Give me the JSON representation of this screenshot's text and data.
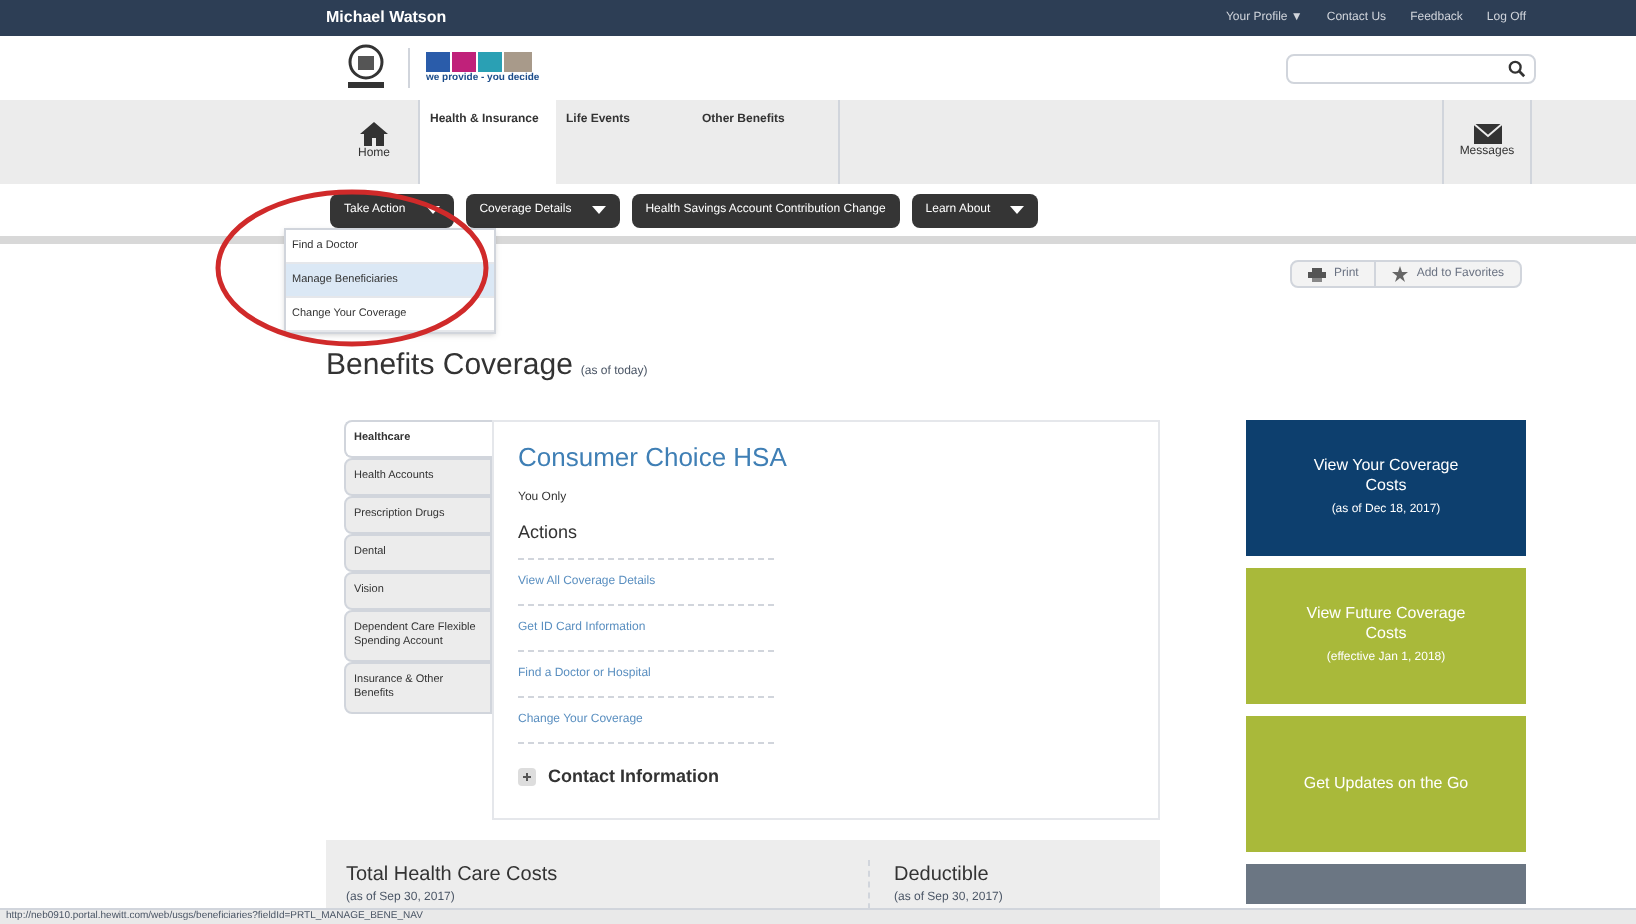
{
  "top_bar": {
    "user": "Michael Watson",
    "links": [
      "Your Profile ▼",
      "Contact Us",
      "Feedback",
      "Log Off"
    ]
  },
  "logo": {
    "tagline": "we provide - you decide"
  },
  "nav": {
    "home": "Home",
    "tabs": [
      {
        "label": "Health & Insurance",
        "selected": true
      },
      {
        "label": "Life Events",
        "selected": false
      },
      {
        "label": "Other Benefits",
        "selected": false
      }
    ],
    "messages": "Messages"
  },
  "subnav": [
    {
      "label": "Take Action",
      "dropdown": true
    },
    {
      "label": "Coverage Details",
      "dropdown": true
    },
    {
      "label": "Health Savings Account Contribution Change",
      "dropdown": false
    },
    {
      "label": "Learn About",
      "dropdown": true
    }
  ],
  "dropdown_menu": [
    {
      "label": "Find a Doctor",
      "selected": false
    },
    {
      "label": "Manage Beneficiaries",
      "selected": true
    },
    {
      "label": "Change Your Coverage",
      "selected": false
    }
  ],
  "page_tools": [
    "Print",
    "Add to Favorites"
  ],
  "heading": {
    "title": "Benefits Coverage",
    "note": "(as of today)"
  },
  "side_tabs": [
    {
      "label": "Healthcare",
      "selected": true
    },
    {
      "label": "Health Accounts",
      "selected": false
    },
    {
      "label": "Prescription Drugs",
      "selected": false
    },
    {
      "label": "Dental",
      "selected": false
    },
    {
      "label": "Vision",
      "selected": false
    },
    {
      "label": "Dependent Care Flexible Spending Account",
      "selected": false
    },
    {
      "label": "Insurance & Other Benefits",
      "selected": false
    }
  ],
  "plan": {
    "name": "Consumer Choice HSA",
    "coverage": "You Only",
    "actions_title": "Actions",
    "actions": [
      "View All Coverage Details",
      "Get ID Card Information",
      "Find a Doctor or Hospital",
      "Change Your Coverage"
    ],
    "contact": "Contact Information"
  },
  "tiles": [
    {
      "title": "View Your Coverage Costs",
      "note": "(as of Dec 18, 2017)",
      "color": "#0d3f6e"
    },
    {
      "title": "View Future Coverage Costs",
      "note": "(effective Jan 1, 2018)",
      "color": "#a9b93a"
    },
    {
      "title": "Get Updates on the Go",
      "color": "#a9b93a"
    },
    {
      "color": "#6b7683"
    }
  ],
  "summary": [
    {
      "title": "Total Health Care Costs",
      "note": "(as of Sep 30, 2017)"
    },
    {
      "title": "Deductible",
      "note": "(as of Sep 30, 2017)"
    }
  ],
  "status_bar": "http://neb0910.portal.hewitt.com/web/usgs/beneficiaries?fieldId=PRTL_MANAGE_BENE_NAV"
}
